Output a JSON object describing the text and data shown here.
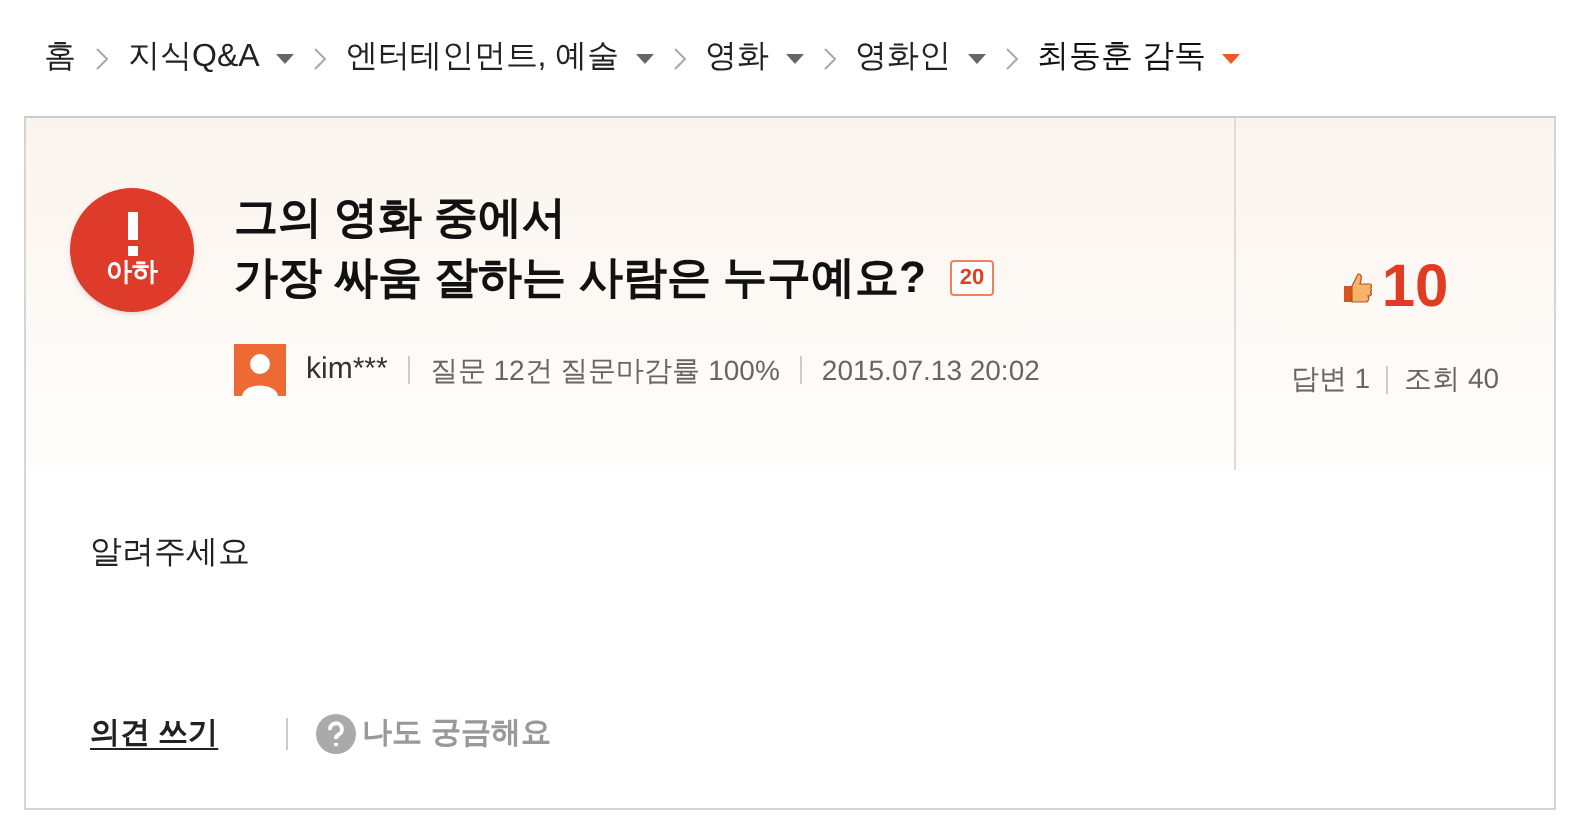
{
  "breadcrumb": [
    {
      "label": "홈",
      "has_menu": false,
      "selected": false
    },
    {
      "label": "지식Q&A",
      "has_menu": true,
      "selected": false
    },
    {
      "label": "엔터테인먼트, 예술",
      "has_menu": true,
      "selected": false
    },
    {
      "label": "영화",
      "has_menu": true,
      "selected": false
    },
    {
      "label": "영화인",
      "has_menu": true,
      "selected": false
    },
    {
      "label": "최동훈 감독",
      "has_menu": true,
      "selected": true
    }
  ],
  "question": {
    "badge": "아하",
    "title_lines": [
      "그의 영화 중에서",
      "가장 싸움 잘하는 사람은 누구예요?"
    ],
    "bounty": "20",
    "author": "kim***",
    "author_stats": "질문 12건 질문마감률 100%",
    "date": "2015.07.13 20:02",
    "likes": "10",
    "answers": "답변 1",
    "views": "조회 40",
    "body": "알려주세요"
  },
  "actions": [
    {
      "label": "의견 쓰기",
      "kind": "link"
    },
    {
      "label": "나도 궁금해요",
      "kind": "help"
    }
  ]
}
